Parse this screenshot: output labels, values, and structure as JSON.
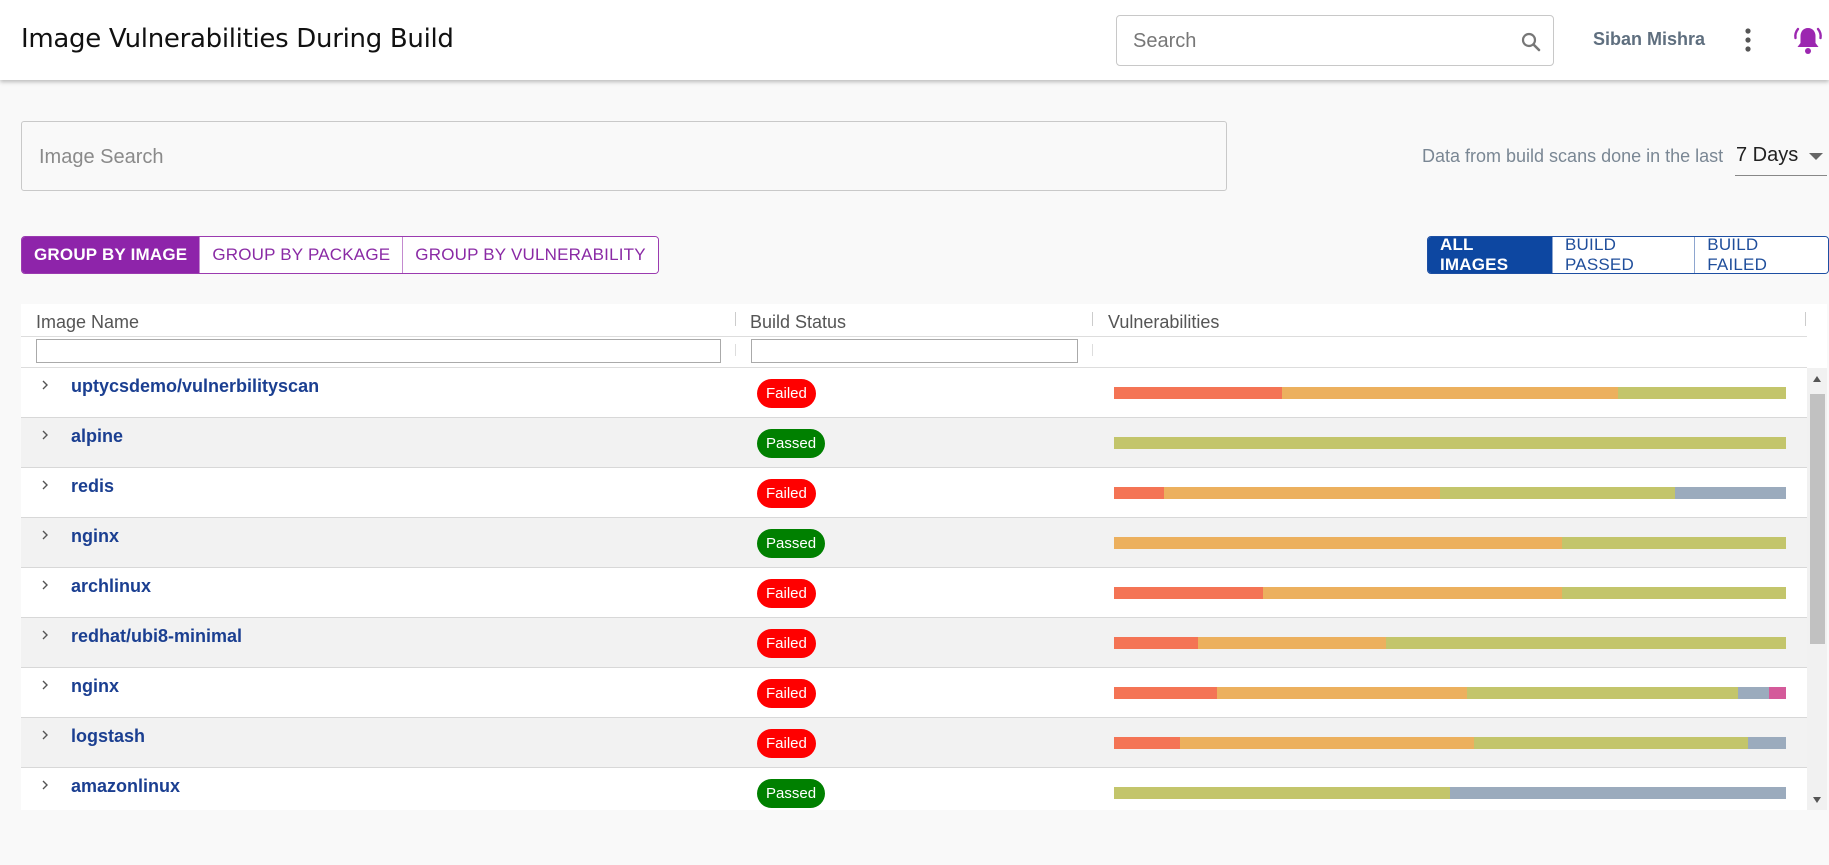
{
  "header": {
    "title": "Image Vulnerabilities During Build",
    "search_placeholder": "Search",
    "user_name": "Siban Mishra"
  },
  "image_search": {
    "placeholder": "Image Search"
  },
  "date_range": {
    "label": "Data from build scans done in the last",
    "value": "7 Days"
  },
  "group_tabs": [
    {
      "label": "GROUP BY IMAGE",
      "active": true
    },
    {
      "label": "GROUP BY PACKAGE",
      "active": false
    },
    {
      "label": "GROUP BY VULNERABILITY",
      "active": false
    }
  ],
  "build_tabs": [
    {
      "label": "ALL IMAGES",
      "active": true
    },
    {
      "label": "BUILD PASSED",
      "active": false
    },
    {
      "label": "BUILD FAILED",
      "active": false
    }
  ],
  "table": {
    "columns": [
      "Image Name",
      "Build Status",
      "Vulnerabilities"
    ],
    "severity_colors": {
      "critical": "#f47455",
      "high": "#ecb05e",
      "medium": "#c3c56b",
      "low": "#9babbd",
      "other": "#d45a9a"
    },
    "status_colors": {
      "Failed": "#ff0000",
      "Passed": "#008000"
    },
    "rows": [
      {
        "name": "uptycsdemo/vulnerbilityscan",
        "status": "Failed",
        "segments": [
          [
            "critical",
            25
          ],
          [
            "high",
            50
          ],
          [
            "medium",
            25
          ]
        ]
      },
      {
        "name": "alpine",
        "status": "Passed",
        "segments": [
          [
            "medium",
            100
          ]
        ]
      },
      {
        "name": "redis",
        "status": "Failed",
        "segments": [
          [
            "critical",
            7.5
          ],
          [
            "high",
            41
          ],
          [
            "medium",
            35
          ],
          [
            "low",
            16.5
          ]
        ]
      },
      {
        "name": "nginx",
        "status": "Passed",
        "segments": [
          [
            "high",
            66.7
          ],
          [
            "medium",
            33.3
          ]
        ]
      },
      {
        "name": "archlinux",
        "status": "Failed",
        "segments": [
          [
            "critical",
            22.2
          ],
          [
            "high",
            44.5
          ],
          [
            "medium",
            33.3
          ]
        ]
      },
      {
        "name": "redhat/ubi8-minimal",
        "status": "Failed",
        "segments": [
          [
            "critical",
            12.5
          ],
          [
            "high",
            28
          ],
          [
            "medium",
            59.5
          ]
        ]
      },
      {
        "name": "nginx",
        "status": "Failed",
        "segments": [
          [
            "critical",
            15.3
          ],
          [
            "high",
            37.2
          ],
          [
            "medium",
            40.3
          ],
          [
            "low",
            4.7
          ],
          [
            "other",
            2.5
          ]
        ]
      },
      {
        "name": "logstash",
        "status": "Failed",
        "segments": [
          [
            "critical",
            9.8
          ],
          [
            "high",
            43.8
          ],
          [
            "medium",
            40.8
          ],
          [
            "low",
            5.6
          ]
        ]
      },
      {
        "name": "amazonlinux",
        "status": "Passed",
        "segments": [
          [
            "medium",
            50
          ],
          [
            "low",
            50
          ]
        ]
      }
    ]
  }
}
